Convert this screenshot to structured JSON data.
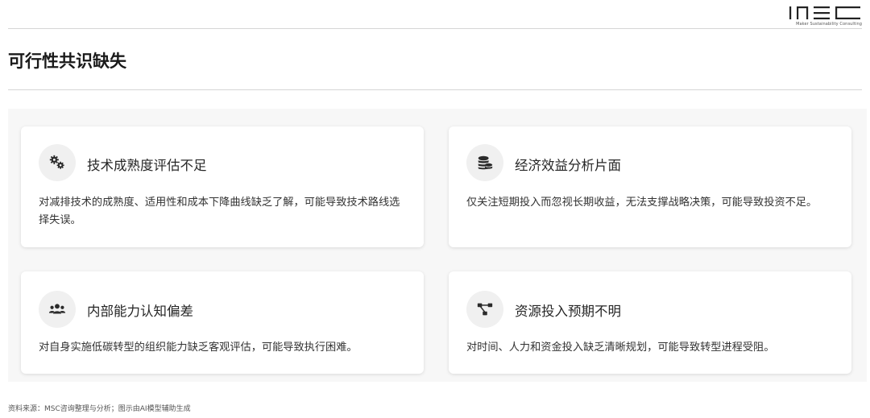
{
  "brand": {
    "logo_text": "MSC",
    "tagline": "Maker Sustainability Consulting"
  },
  "page": {
    "title": "可行性共识缺失"
  },
  "cards": [
    {
      "icon": "gears-icon",
      "title": "技术成熟度评估不足",
      "description": "对减排技术的成熟度、适用性和成本下降曲线缺乏了解，可能导致技术路线选择失误。"
    },
    {
      "icon": "coins-icon",
      "title": "经济效益分析片面",
      "description": "仅关注短期投入而忽视长期收益，无法支撑战略决策，可能导致投资不足。"
    },
    {
      "icon": "users-icon",
      "title": "内部能力认知偏差",
      "description": "对自身实施低碳转型的组织能力缺乏客观评估，可能导致执行困难。"
    },
    {
      "icon": "project-diagram-icon",
      "title": "资源投入预期不明",
      "description": "对时间、人力和资金投入缺乏清晰规划，可能导致转型进程受阻。"
    }
  ],
  "footer": {
    "source": "资料来源：MSC咨询整理与分析；图示由AI模型辅助生成"
  },
  "colors": {
    "icon": "#2b2b2b",
    "icon_bg": "#f0f0f0",
    "panel_bg": "#f7f7f7"
  }
}
